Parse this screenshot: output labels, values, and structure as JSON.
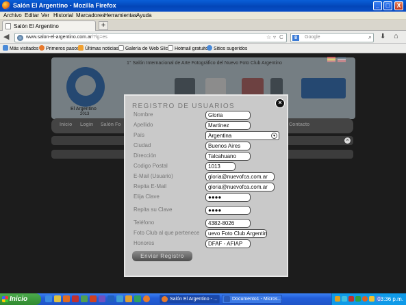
{
  "window": {
    "title": "Salón El Argentino - Mozilla Firefox",
    "minimize": "_",
    "maximize": "□",
    "close": "X"
  },
  "menu": [
    "Archivo",
    "Editar",
    "Ver",
    "Historial",
    "Marcadores",
    "Herramientas",
    "Ayuda"
  ],
  "tab": {
    "label": "Salón El Argentino",
    "new_tab": "+"
  },
  "nav": {
    "url_domain": "www.salon-el-argentino.com.ar",
    "url_rest": "/?lg=es",
    "search_placeholder": "Google",
    "search_engine_letter": "8"
  },
  "bookmarks": [
    "Más visitados",
    "Primeros pasos",
    "Últimas noticias",
    "Galería de Web Slice",
    "Hotmail gratuito",
    "Sitios sugeridos"
  ],
  "site": {
    "banner_title": "1° Salón Internacional de Arte Fotográfico del Nuevo Foto Club Argentino",
    "site_name": "El Argentino",
    "year": "2013",
    "nav_items": [
      "Inicio",
      "Login",
      "Salón Fo",
      "Contacto"
    ]
  },
  "modal": {
    "title": "REGISTRO DE USUARIOS",
    "close_symbol": "×",
    "fields": {
      "nombre": {
        "label": "Nombre",
        "value": "Gloria"
      },
      "apellido": {
        "label": "Apellido",
        "value": "Martinez"
      },
      "pais": {
        "label": "País",
        "value": "Argentina"
      },
      "ciudad": {
        "label": "Ciudad",
        "value": "Buenos Aires"
      },
      "direccion": {
        "label": "Dirección",
        "value": "Talcahuano"
      },
      "codigo_postal": {
        "label": "Codigo Postal",
        "value": "1013"
      },
      "email": {
        "label": "E-Mail (Usuario)",
        "value": "gloria@nuevofca.com.ar"
      },
      "repita_email": {
        "label": "Repita E-Mail",
        "value": "gloria@nuevofca.com.ar"
      },
      "clave": {
        "label": "Elija Clave",
        "value": "●●●●"
      },
      "repita_clave": {
        "label": "Repita su Clave",
        "value": "●●●●"
      },
      "telefono": {
        "label": "Teléfono",
        "value": "4382-8026"
      },
      "foto_club": {
        "label": "Foto Club al que pertenece",
        "value": "uevo Foto Club Argentino"
      },
      "honores": {
        "label": "Honores",
        "value": "DFAF - AFIAP"
      }
    },
    "submit_label": "Enviar Registro"
  },
  "taskbar": {
    "start_label": "Inicio",
    "tasks": [
      "Salón El Argentino - ...",
      "Documento1 - Micros..."
    ],
    "clock": "03:36 p.m."
  },
  "colors": {
    "titlebar": "#0346b8",
    "taskbar": "#235ed9",
    "start": "#2f8a2f",
    "site_blue": "#2e6db8"
  }
}
